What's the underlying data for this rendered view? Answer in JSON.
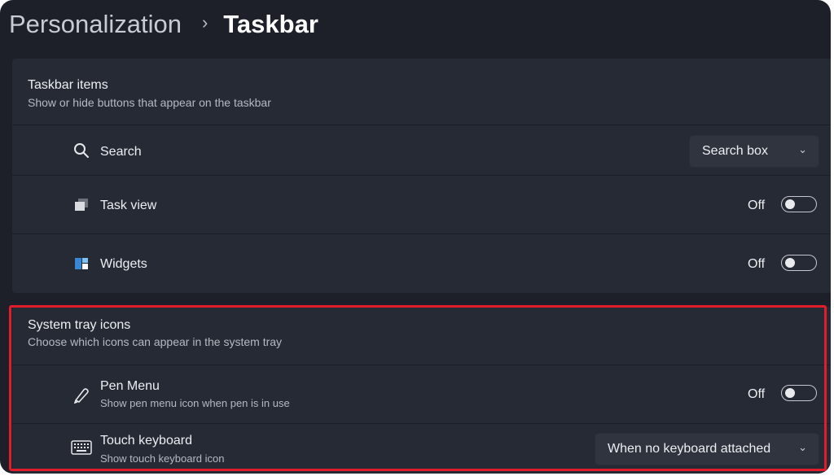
{
  "breadcrumb": {
    "parent": "Personalization",
    "separator": "›",
    "current": "Taskbar"
  },
  "taskbar_items": {
    "title": "Taskbar items",
    "description": "Show or hide buttons that appear on the taskbar",
    "items": [
      {
        "label": "Search",
        "icon": "search-icon",
        "control": "dropdown",
        "value": "Search box"
      },
      {
        "label": "Task view",
        "icon": "task-view-icon",
        "control": "toggle",
        "state": "Off"
      },
      {
        "label": "Widgets",
        "icon": "widgets-icon",
        "control": "toggle",
        "state": "Off"
      }
    ]
  },
  "system_tray": {
    "title": "System tray icons",
    "description": "Choose which icons can appear in the system tray",
    "items": [
      {
        "label": "Pen Menu",
        "sublabel": "Show pen menu icon when pen is in use",
        "icon": "pen-icon",
        "control": "toggle",
        "state": "Off"
      },
      {
        "label": "Touch keyboard",
        "sublabel": "Show touch keyboard icon",
        "icon": "keyboard-icon",
        "control": "dropdown",
        "value": "When no keyboard attached"
      }
    ]
  },
  "colors": {
    "background": "#1d2029",
    "card": "#262a34",
    "highlight": "#e11d2b"
  }
}
